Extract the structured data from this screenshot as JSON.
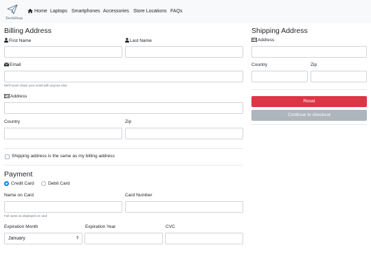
{
  "brand": {
    "logo_text": "TechShop"
  },
  "nav": {
    "items": [
      {
        "label": "Home"
      },
      {
        "label": "Laptops"
      },
      {
        "label": "Smartphones"
      },
      {
        "label": "Accessories"
      },
      {
        "label": "Store Locations"
      },
      {
        "label": "FAQs"
      }
    ]
  },
  "billing": {
    "title": "Billing Address",
    "first_name_label": "First Name",
    "first_name_value": "",
    "last_name_label": "Last Name",
    "last_name_value": "",
    "email_label": "Email",
    "email_value": "",
    "email_help": "We'll never share your email with anyone else.",
    "address_label": "Address",
    "address_value": "",
    "country_label": "Country",
    "country_value": "",
    "zip_label": "Zip",
    "zip_value": "",
    "same_address_label": "Shipping address is the same as my billing address",
    "same_address_checked": false
  },
  "payment": {
    "title": "Payment",
    "methods": [
      {
        "label": "Credit Card",
        "checked": true
      },
      {
        "label": "Debit Card",
        "checked": false
      }
    ],
    "name_label": "Name on Card",
    "name_value": "",
    "name_help": "Full name as displayed on card",
    "number_label": "Card Number",
    "number_value": "",
    "month_label": "Expiration Month",
    "month_value": "January",
    "year_label": "Expiration Year",
    "year_value": "",
    "cvc_label": "CVC",
    "cvc_value": ""
  },
  "shipping": {
    "title": "Shipping Address",
    "address_label": "Address",
    "address_value": "",
    "country_label": "Country",
    "country_value": "",
    "zip_label": "Zip",
    "zip_value": "",
    "reset_label": "Reset",
    "checkout_label": "Continue to checkout"
  },
  "colors": {
    "navbar_bg": "#f8f9fa",
    "danger": "#dc3545",
    "secondary": "#adb5bd",
    "primary": "#007bff",
    "border": "#ced4da"
  },
  "icons": {
    "brand": "paper-plane-icon",
    "home": "home-icon",
    "user": "user-icon",
    "email": "envelope-icon",
    "address": "address-card-icon"
  }
}
